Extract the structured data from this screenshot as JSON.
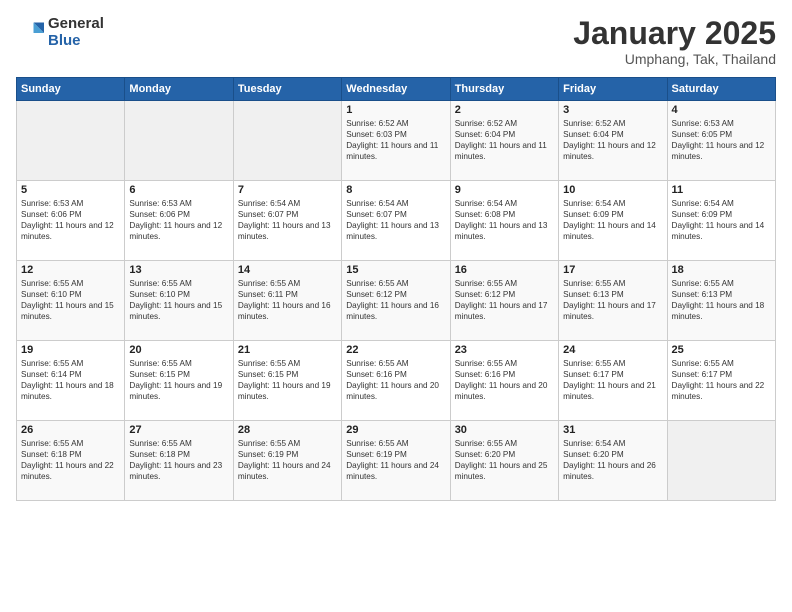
{
  "logo": {
    "general": "General",
    "blue": "Blue"
  },
  "header": {
    "month": "January 2025",
    "location": "Umphang, Tak, Thailand"
  },
  "weekdays": [
    "Sunday",
    "Monday",
    "Tuesday",
    "Wednesday",
    "Thursday",
    "Friday",
    "Saturday"
  ],
  "weeks": [
    [
      {
        "day": "",
        "empty": true
      },
      {
        "day": "",
        "empty": true
      },
      {
        "day": "",
        "empty": true
      },
      {
        "day": "1",
        "sunrise": "6:52 AM",
        "sunset": "6:03 PM",
        "daylight": "11 hours and 11 minutes."
      },
      {
        "day": "2",
        "sunrise": "6:52 AM",
        "sunset": "6:04 PM",
        "daylight": "11 hours and 11 minutes."
      },
      {
        "day": "3",
        "sunrise": "6:52 AM",
        "sunset": "6:04 PM",
        "daylight": "11 hours and 12 minutes."
      },
      {
        "day": "4",
        "sunrise": "6:53 AM",
        "sunset": "6:05 PM",
        "daylight": "11 hours and 12 minutes."
      }
    ],
    [
      {
        "day": "5",
        "sunrise": "6:53 AM",
        "sunset": "6:06 PM",
        "daylight": "11 hours and 12 minutes."
      },
      {
        "day": "6",
        "sunrise": "6:53 AM",
        "sunset": "6:06 PM",
        "daylight": "11 hours and 12 minutes."
      },
      {
        "day": "7",
        "sunrise": "6:54 AM",
        "sunset": "6:07 PM",
        "daylight": "11 hours and 13 minutes."
      },
      {
        "day": "8",
        "sunrise": "6:54 AM",
        "sunset": "6:07 PM",
        "daylight": "11 hours and 13 minutes."
      },
      {
        "day": "9",
        "sunrise": "6:54 AM",
        "sunset": "6:08 PM",
        "daylight": "11 hours and 13 minutes."
      },
      {
        "day": "10",
        "sunrise": "6:54 AM",
        "sunset": "6:09 PM",
        "daylight": "11 hours and 14 minutes."
      },
      {
        "day": "11",
        "sunrise": "6:54 AM",
        "sunset": "6:09 PM",
        "daylight": "11 hours and 14 minutes."
      }
    ],
    [
      {
        "day": "12",
        "sunrise": "6:55 AM",
        "sunset": "6:10 PM",
        "daylight": "11 hours and 15 minutes."
      },
      {
        "day": "13",
        "sunrise": "6:55 AM",
        "sunset": "6:10 PM",
        "daylight": "11 hours and 15 minutes."
      },
      {
        "day": "14",
        "sunrise": "6:55 AM",
        "sunset": "6:11 PM",
        "daylight": "11 hours and 16 minutes."
      },
      {
        "day": "15",
        "sunrise": "6:55 AM",
        "sunset": "6:12 PM",
        "daylight": "11 hours and 16 minutes."
      },
      {
        "day": "16",
        "sunrise": "6:55 AM",
        "sunset": "6:12 PM",
        "daylight": "11 hours and 17 minutes."
      },
      {
        "day": "17",
        "sunrise": "6:55 AM",
        "sunset": "6:13 PM",
        "daylight": "11 hours and 17 minutes."
      },
      {
        "day": "18",
        "sunrise": "6:55 AM",
        "sunset": "6:13 PM",
        "daylight": "11 hours and 18 minutes."
      }
    ],
    [
      {
        "day": "19",
        "sunrise": "6:55 AM",
        "sunset": "6:14 PM",
        "daylight": "11 hours and 18 minutes."
      },
      {
        "day": "20",
        "sunrise": "6:55 AM",
        "sunset": "6:15 PM",
        "daylight": "11 hours and 19 minutes."
      },
      {
        "day": "21",
        "sunrise": "6:55 AM",
        "sunset": "6:15 PM",
        "daylight": "11 hours and 19 minutes."
      },
      {
        "day": "22",
        "sunrise": "6:55 AM",
        "sunset": "6:16 PM",
        "daylight": "11 hours and 20 minutes."
      },
      {
        "day": "23",
        "sunrise": "6:55 AM",
        "sunset": "6:16 PM",
        "daylight": "11 hours and 20 minutes."
      },
      {
        "day": "24",
        "sunrise": "6:55 AM",
        "sunset": "6:17 PM",
        "daylight": "11 hours and 21 minutes."
      },
      {
        "day": "25",
        "sunrise": "6:55 AM",
        "sunset": "6:17 PM",
        "daylight": "11 hours and 22 minutes."
      }
    ],
    [
      {
        "day": "26",
        "sunrise": "6:55 AM",
        "sunset": "6:18 PM",
        "daylight": "11 hours and 22 minutes."
      },
      {
        "day": "27",
        "sunrise": "6:55 AM",
        "sunset": "6:18 PM",
        "daylight": "11 hours and 23 minutes."
      },
      {
        "day": "28",
        "sunrise": "6:55 AM",
        "sunset": "6:19 PM",
        "daylight": "11 hours and 24 minutes."
      },
      {
        "day": "29",
        "sunrise": "6:55 AM",
        "sunset": "6:19 PM",
        "daylight": "11 hours and 24 minutes."
      },
      {
        "day": "30",
        "sunrise": "6:55 AM",
        "sunset": "6:20 PM",
        "daylight": "11 hours and 25 minutes."
      },
      {
        "day": "31",
        "sunrise": "6:54 AM",
        "sunset": "6:20 PM",
        "daylight": "11 hours and 26 minutes."
      },
      {
        "day": "",
        "empty": true
      }
    ]
  ]
}
